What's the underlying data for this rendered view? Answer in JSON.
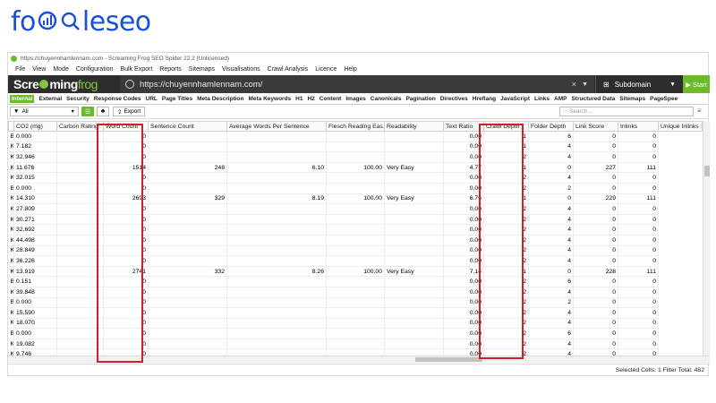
{
  "brand": {
    "prefix": "fo",
    "suffix": "leseo"
  },
  "window": {
    "title": "https://chuyennhamlennam.com - Screaming Frog SEO Spider 22.2 (Unlicensed)"
  },
  "menu": [
    "File",
    "View",
    "Mode",
    "Configuration",
    "Bulk Export",
    "Reports",
    "Sitemaps",
    "Visualisations",
    "Crawl Analysis",
    "Licence",
    "Help"
  ],
  "toolbar": {
    "logo_scre": "Scre",
    "logo_ming": "ming",
    "logo_frog": "frog",
    "url": "https://chuyennhamlennam.com/",
    "clear": "×",
    "mode": "Subdomain",
    "start": "Start"
  },
  "tabs": [
    "Internal",
    "External",
    "Security",
    "Response Codes",
    "URL",
    "Page Titles",
    "Meta Description",
    "Meta Keywords",
    "H1",
    "H2",
    "Content",
    "Images",
    "Canonicals",
    "Pagination",
    "Directives",
    "Hreflang",
    "JavaScript",
    "Links",
    "AMP",
    "Structured Data",
    "Sitemaps",
    "PageSpee"
  ],
  "filter": {
    "value": "All",
    "export_label": "Export",
    "search_placeholder": "Search..."
  },
  "table": {
    "columns": [
      "CO2 (mg)",
      "Carbon Rating",
      "Word Count",
      "Sentence Count",
      "Average Words Per Sentence",
      "Flesch Reading Eas...",
      "Readability",
      "Text Ratio",
      "Crawl Depth",
      "Folder Depth",
      "Link Score",
      "Inlinks",
      "Unique Inlinks"
    ],
    "rows": [
      [
        "B",
        "0.000",
        "",
        "0",
        "",
        "",
        "",
        "",
        "0.00",
        "1",
        "6",
        "",
        "0",
        "0"
      ],
      [
        "KB",
        "7.182",
        "",
        "0",
        "",
        "",
        "",
        "",
        "0.00",
        "1",
        "4",
        "",
        "0",
        "0"
      ],
      [
        "KB",
        "32.946",
        "",
        "0",
        "",
        "",
        "",
        "",
        "0.00",
        "2",
        "4",
        "",
        "0",
        "0"
      ],
      [
        "KB",
        "11.676",
        "",
        "1514",
        "248",
        "6.10",
        "100.00",
        "Very Easy",
        "4.77",
        "1",
        "0",
        "",
        "227",
        "111"
      ],
      [
        "KB",
        "32.015",
        "",
        "0",
        "",
        "",
        "",
        "",
        "0.00",
        "2",
        "4",
        "",
        "0",
        "0"
      ],
      [
        "B",
        "0.000",
        "",
        "0",
        "",
        "",
        "",
        "",
        "0.00",
        "2",
        "2",
        "",
        "0",
        "0"
      ],
      [
        "KB",
        "14.310",
        "",
        "2693",
        "329",
        "8.19",
        "100.00",
        "Very Easy",
        "6.76",
        "1",
        "0",
        "",
        "229",
        "111"
      ],
      [
        "KB",
        "27.809",
        "",
        "0",
        "",
        "",
        "",
        "",
        "0.00",
        "2",
        "4",
        "",
        "0",
        "0"
      ],
      [
        "KB",
        "30.271",
        "",
        "0",
        "",
        "",
        "",
        "",
        "0.00",
        "2",
        "4",
        "",
        "0",
        "0"
      ],
      [
        "KB",
        "32.692",
        "",
        "0",
        "",
        "",
        "",
        "",
        "0.00",
        "2",
        "4",
        "",
        "0",
        "0"
      ],
      [
        "KB",
        "44.498",
        "",
        "0",
        "",
        "",
        "",
        "",
        "0.00",
        "2",
        "4",
        "",
        "0",
        "0"
      ],
      [
        "KB",
        "28.849",
        "",
        "0",
        "",
        "",
        "",
        "",
        "0.00",
        "2",
        "4",
        "",
        "0",
        "0"
      ],
      [
        "KB",
        "36.226",
        "",
        "0",
        "",
        "",
        "",
        "",
        "0.00",
        "2",
        "4",
        "",
        "0",
        "0"
      ],
      [
        "KB",
        "13.919",
        "",
        "2741",
        "332",
        "8.26",
        "100.00",
        "Very Easy",
        "7.14",
        "1",
        "0",
        "",
        "228",
        "111"
      ],
      [
        "B",
        "0.151",
        "",
        "0",
        "",
        "",
        "",
        "",
        "0.00",
        "2",
        "6",
        "",
        "0",
        "0"
      ],
      [
        "KB",
        "39.848",
        "",
        "0",
        "",
        "",
        "",
        "",
        "0.00",
        "2",
        "4",
        "",
        "0",
        "0"
      ],
      [
        "B",
        "0.000",
        "",
        "0",
        "",
        "",
        "",
        "",
        "0.00",
        "2",
        "2",
        "",
        "0",
        "0"
      ],
      [
        "KB",
        "15.590",
        "",
        "0",
        "",
        "",
        "",
        "",
        "0.00",
        "2",
        "4",
        "",
        "0",
        "0"
      ],
      [
        "KB",
        "18.070",
        "",
        "0",
        "",
        "",
        "",
        "",
        "0.00",
        "2",
        "4",
        "",
        "0",
        "0"
      ],
      [
        "B",
        "0.000",
        "",
        "0",
        "",
        "",
        "",
        "",
        "0.00",
        "2",
        "6",
        "",
        "0",
        "0"
      ],
      [
        "KB",
        "19.082",
        "",
        "0",
        "",
        "",
        "",
        "",
        "0.00",
        "2",
        "4",
        "",
        "0",
        "0"
      ],
      [
        "KB",
        "9.746",
        "",
        "0",
        "",
        "",
        "",
        "",
        "0.00",
        "2",
        "4",
        "",
        "0",
        "0"
      ]
    ]
  },
  "status": {
    "text": "Selected Cells: 1  Filter Total: 482"
  },
  "colors": {
    "accent": "#6cbb2a",
    "highlight": "#d21f26",
    "brand": "#1b4fd6"
  }
}
